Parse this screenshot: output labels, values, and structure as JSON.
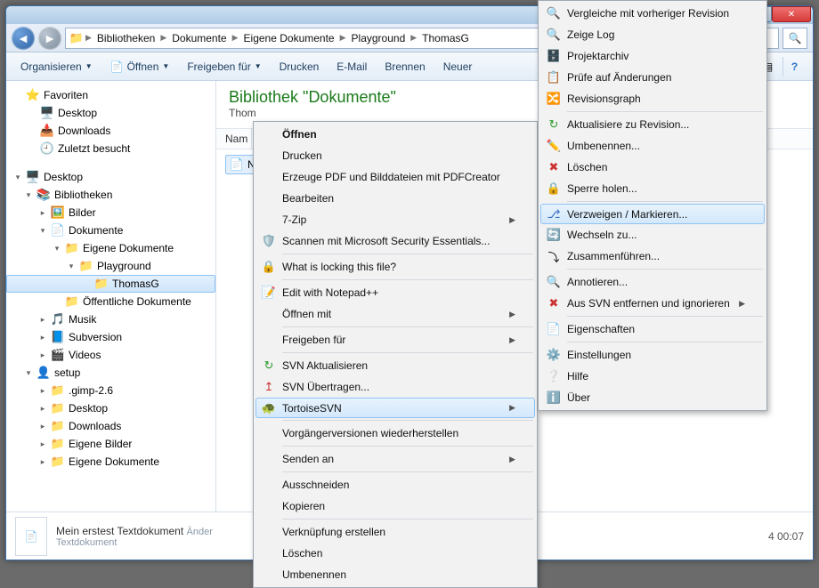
{
  "titlebar": {
    "close": "X",
    "min": "–",
    "max": "▢"
  },
  "breadcrumbs": [
    "Bibliotheken",
    "Dokumente",
    "Eigene Dokumente",
    "Playground",
    "ThomasG"
  ],
  "toolbar": {
    "organize": "Organisieren",
    "open": "Öffnen",
    "share": "Freigeben für",
    "print": "Drucken",
    "email": "E-Mail",
    "burn": "Brennen",
    "new": "Neuer"
  },
  "sidebar": {
    "favorites": "Favoriten",
    "desktop": "Desktop",
    "downloads": "Downloads",
    "recent": "Zuletzt besucht",
    "desktop2": "Desktop",
    "libraries": "Bibliotheken",
    "pictures": "Bilder",
    "documents": "Dokumente",
    "owndocs": "Eigene Dokumente",
    "playground": "Playground",
    "thomasg": "ThomasG",
    "publicdocs": "Öffentliche Dokumente",
    "music": "Musik",
    "subversion": "Subversion",
    "videos": "Videos",
    "setup": "setup",
    "gimp": ".gimp-2.6",
    "desktop3": "Desktop",
    "downloads2": "Downloads",
    "ownpics": "Eigene Bilder",
    "owndocs2": "Eigene Dokumente"
  },
  "main": {
    "lib_title": "Bibliothek \"Dokumente\"",
    "lib_sub_prefix": "Thom",
    "col_name": "Nam",
    "file_prefix": "N"
  },
  "details": {
    "name": "Mein erstest Textdokument",
    "changed_label": "Änder",
    "type": "Textdokument",
    "date_suffix": "4 00:07"
  },
  "ctx1": {
    "open": "Öffnen",
    "print": "Drucken",
    "pdf": "Erzeuge PDF und Bilddateien mit PDFCreator",
    "edit": "Bearbeiten",
    "zip": "7-Zip",
    "scan": "Scannen mit Microsoft Security Essentials...",
    "locking": "What is locking this file?",
    "notepad": "Edit with Notepad++",
    "openwith": "Öffnen mit",
    "share": "Freigeben für",
    "svn_update": "SVN Aktualisieren",
    "svn_commit": "SVN Übertragen...",
    "tortoise": "TortoiseSVN",
    "prev_versions": "Vorgängerversionen wiederherstellen",
    "send": "Senden an",
    "cut": "Ausschneiden",
    "copy": "Kopieren",
    "shortcut": "Verknüpfung erstellen",
    "delete": "Löschen",
    "rename": "Umbenennen"
  },
  "ctx2": {
    "diff_prev": "Vergleiche mit vorheriger Revision",
    "log": "Zeige Log",
    "repo": "Projektarchiv",
    "check_mod": "Prüfe auf Änderungen",
    "revgraph": "Revisionsgraph",
    "update_rev": "Aktualisiere zu Revision...",
    "rename": "Umbenennen...",
    "delete": "Löschen",
    "lock": "Sperre holen...",
    "branch_tag": "Verzweigen / Markieren...",
    "switch": "Wechseln zu...",
    "merge": "Zusammenführen...",
    "annotate": "Annotieren...",
    "svn_remove": "Aus SVN entfernen und ignorieren",
    "properties": "Eigenschaften",
    "settings": "Einstellungen",
    "help": "Hilfe",
    "about": "Über"
  }
}
